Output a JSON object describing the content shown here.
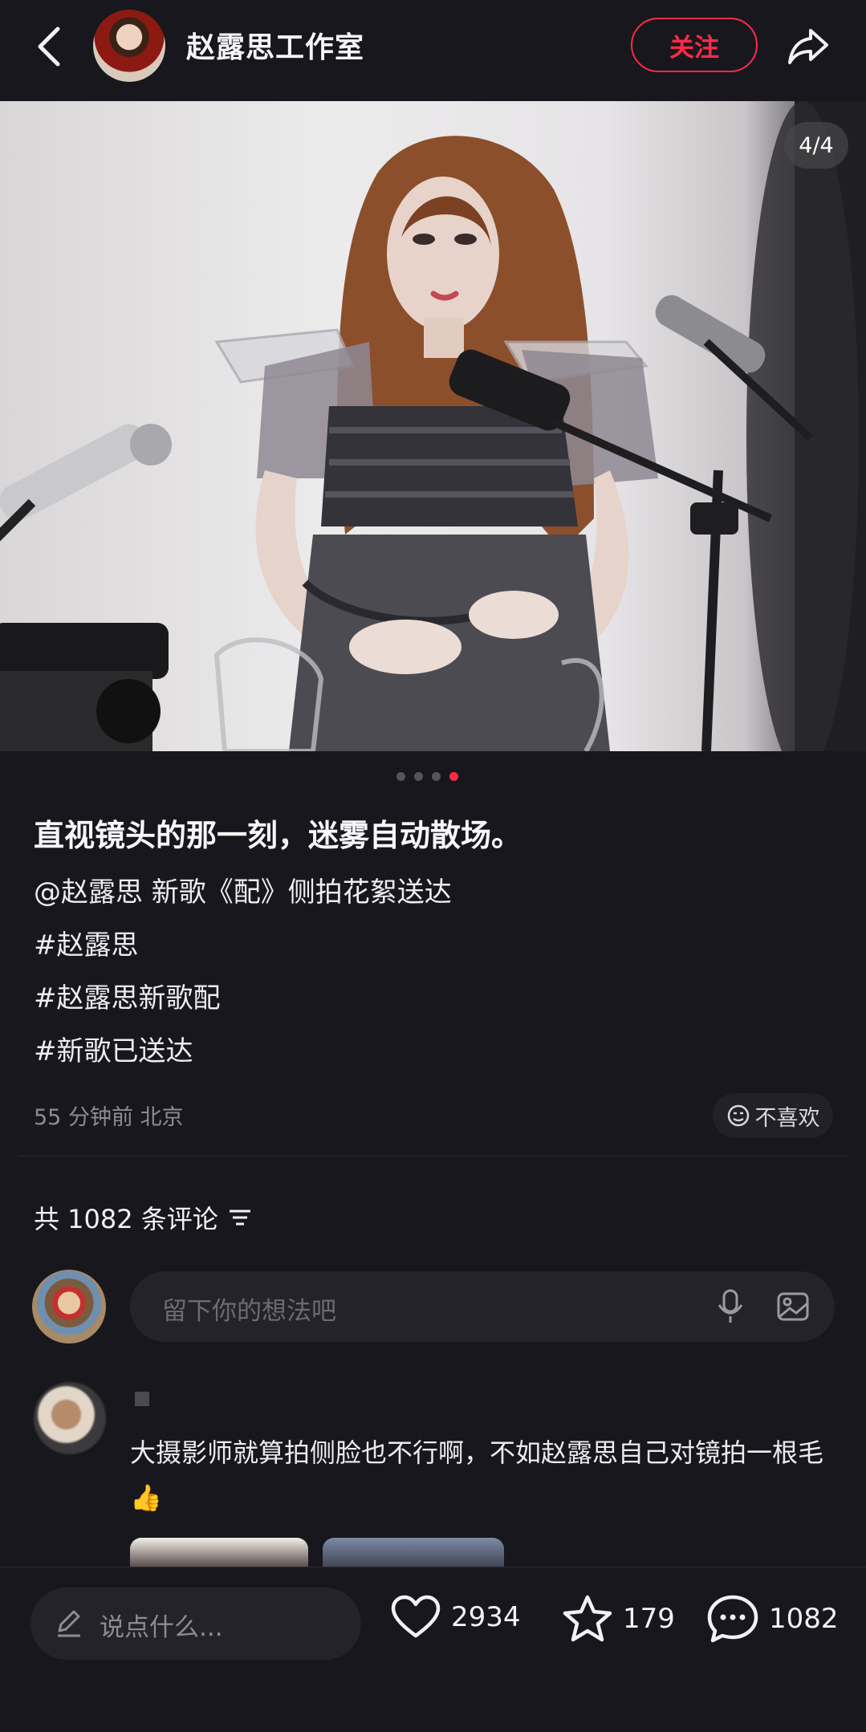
{
  "header": {
    "title": "赵露思工作室",
    "follow_label": "关注"
  },
  "post": {
    "page_counter": "4/4",
    "current_page": 4,
    "total_pages": 4,
    "title": "直视镜头的那一刻，迷雾自动散场。",
    "lines": [
      "@赵露思 新歌《配》侧拍花絮送达",
      "#赵露思",
      "#赵露思新歌配",
      "#新歌已送达"
    ],
    "meta": "55 分钟前 北京",
    "dislike_label": "不喜欢"
  },
  "comments": {
    "count_label": "共 1082 条评论",
    "input_placeholder": "留下你的想法吧",
    "items": [
      {
        "text": "大摄影师就算拍侧脸也不行啊，不如赵露思自己对镜拍一根毛👍"
      }
    ]
  },
  "bottom_bar": {
    "say_placeholder": "说点什么...",
    "likes": "2934",
    "favorites": "179",
    "comments": "1082"
  },
  "colors": {
    "accent": "#ff2a4a",
    "background": "#18171d",
    "muted_text": "#8d8c93"
  },
  "icons": [
    "back-icon",
    "share-icon",
    "smile-icon",
    "sort-icon",
    "mic-icon",
    "image-icon",
    "pencil-icon",
    "heart-icon",
    "star-icon",
    "chat-icon"
  ]
}
